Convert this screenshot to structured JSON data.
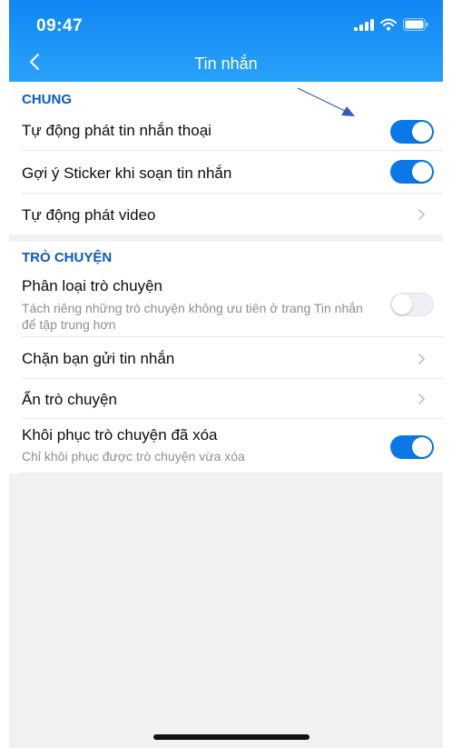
{
  "status": {
    "time": "09:47"
  },
  "nav": {
    "title": "Tin nhắn"
  },
  "sections": {
    "general": {
      "title": "CHUNG",
      "auto_voice": "Tự động phát tin nhắn thoại",
      "sticker_suggest": "Gợi ý Sticker khi soạn tin nhắn",
      "auto_video": "Tự động phát video"
    },
    "chat": {
      "title": "TRÒ CHUYỆN",
      "classify": "Phân loại trò chuyện",
      "classify_desc": "Tách riêng những trò chuyện không ưu tiên ở trang Tin nhắn để tập trung hơn",
      "block": "Chặn bạn gửi tin nhắn",
      "hide": "Ẩn trò chuyện",
      "restore": "Khôi phục trò chuyện đã xóa",
      "restore_desc": "Chỉ khôi phục được trò chuyện vừa xóa"
    }
  },
  "toggles": {
    "auto_voice": true,
    "sticker_suggest": true,
    "classify": false,
    "restore": true
  },
  "icons": {
    "signal": "signal-icon",
    "wifi": "wifi-icon",
    "battery": "battery-icon",
    "back": "chevron-left-icon",
    "chevron": "chevron-right-icon",
    "annotation": "annotation-arrow-icon"
  },
  "colors": {
    "header": "#1592f6",
    "section_title": "#0a5bc4",
    "toggle_on": "#0b78e8",
    "background": "#f0f1f3"
  }
}
